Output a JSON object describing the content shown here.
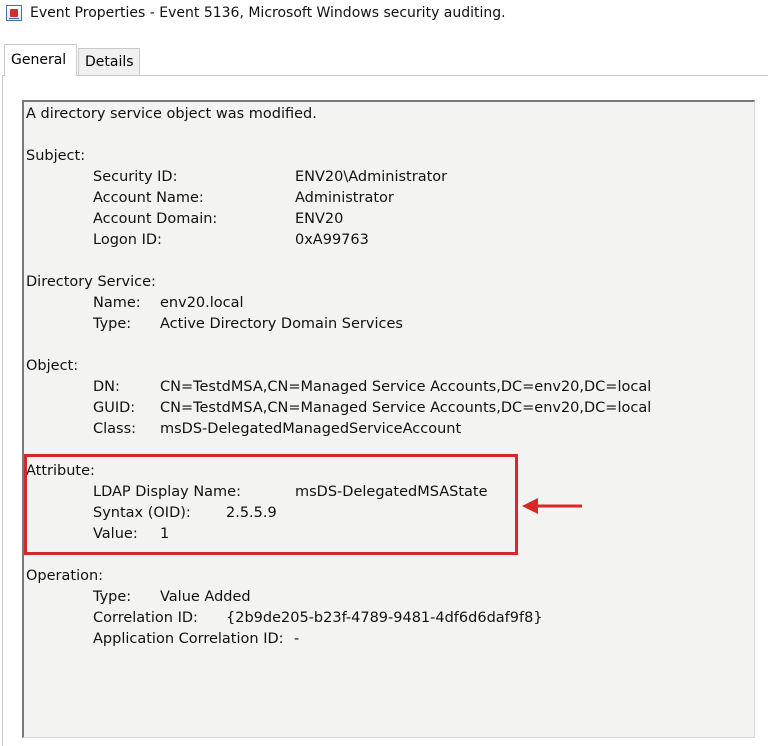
{
  "window": {
    "title": "Event Properties - Event 5136, Microsoft Windows security auditing."
  },
  "tabs": [
    {
      "label": "General",
      "active": true
    },
    {
      "label": "Details",
      "active": false
    }
  ],
  "description": {
    "summary": "A directory service object was modified.",
    "subject": {
      "heading": "Subject:",
      "fields": [
        {
          "label": "Security ID:",
          "value": "ENV20\\Administrator"
        },
        {
          "label": "Account Name:",
          "value": "Administrator"
        },
        {
          "label": "Account Domain:",
          "value": "ENV20"
        },
        {
          "label": "Logon ID:",
          "value": "0xA99763"
        }
      ]
    },
    "directory_service": {
      "heading": "Directory Service:",
      "fields": [
        {
          "label": "Name:",
          "value": "env20.local"
        },
        {
          "label": "Type:",
          "value": "Active Directory Domain Services"
        }
      ]
    },
    "object": {
      "heading": "Object:",
      "fields": [
        {
          "label": "DN:",
          "value": "CN=TestdMSA,CN=Managed Service Accounts,DC=env20,DC=local"
        },
        {
          "label": "GUID:",
          "value": "CN=TestdMSA,CN=Managed Service Accounts,DC=env20,DC=local"
        },
        {
          "label": "Class:",
          "value": "msDS-DelegatedManagedServiceAccount"
        }
      ]
    },
    "attribute": {
      "heading": "Attribute:",
      "fields": [
        {
          "label": "LDAP Display Name:",
          "value": "msDS-DelegatedMSAState"
        },
        {
          "label": "Syntax (OID):",
          "value": "2.5.5.9"
        },
        {
          "label": "Value:",
          "value": "1"
        }
      ]
    },
    "operation": {
      "heading": "Operation:",
      "fields": [
        {
          "label": "Type:",
          "value": "Value Added"
        },
        {
          "label": "Correlation ID:",
          "value": "{2b9de205-b23f-4789-9481-4df6d6daf9f8}"
        },
        {
          "label": "Application Correlation ID:",
          "value": "-"
        }
      ]
    }
  },
  "annotation": {
    "color": "#d62828"
  }
}
